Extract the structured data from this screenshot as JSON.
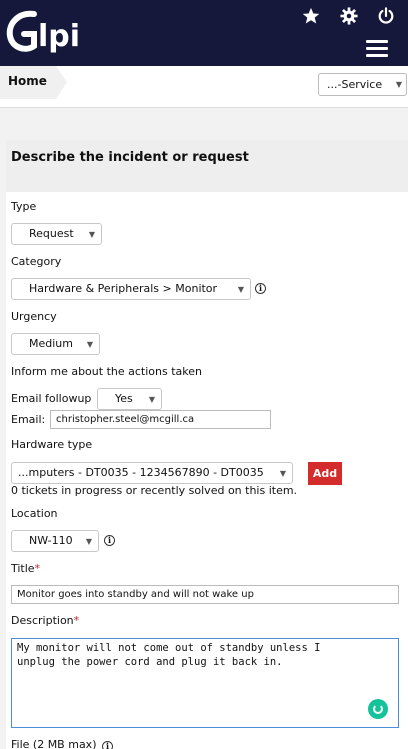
{
  "app": {
    "brand": "Glpi",
    "brand_color": "#15183a",
    "accent_color": "#d42b2b"
  },
  "header": {
    "icons": [
      "star-icon",
      "gear-icon",
      "power-icon",
      "hamburger-menu-icon"
    ]
  },
  "breadcrumb": {
    "home": "Home"
  },
  "entity_selector": {
    "value": "...-Service"
  },
  "form": {
    "title": "Describe the incident or request",
    "type": {
      "label": "Type",
      "value": "Request"
    },
    "category": {
      "label": "Category",
      "value": "Hardware & Peripherals > Monitor"
    },
    "urgency": {
      "label": "Urgency",
      "value": "Medium"
    },
    "inform_label": "Inform me about the actions taken",
    "email_followup": {
      "label": "Email followup",
      "value": "Yes"
    },
    "email": {
      "label": "Email:",
      "value": "christopher.steel@mcgill.ca"
    },
    "hardware": {
      "label": "Hardware type",
      "value": "...mputers - DT0035 - 1234567890 - DT0035",
      "add_label": "Add",
      "tickets_note": "0 tickets in progress or recently solved on this item."
    },
    "location": {
      "label": "Location",
      "value": "NW-110"
    },
    "title_field": {
      "label": "Title",
      "required_mark": "*",
      "value": "Monitor goes into standby and will not wake up"
    },
    "description": {
      "label": "Description",
      "required_mark": "*",
      "value": "My monitor will not come out of standby unless I\nunplug the power cord and plug it back in."
    },
    "file_label": "File (2 MB max)"
  }
}
